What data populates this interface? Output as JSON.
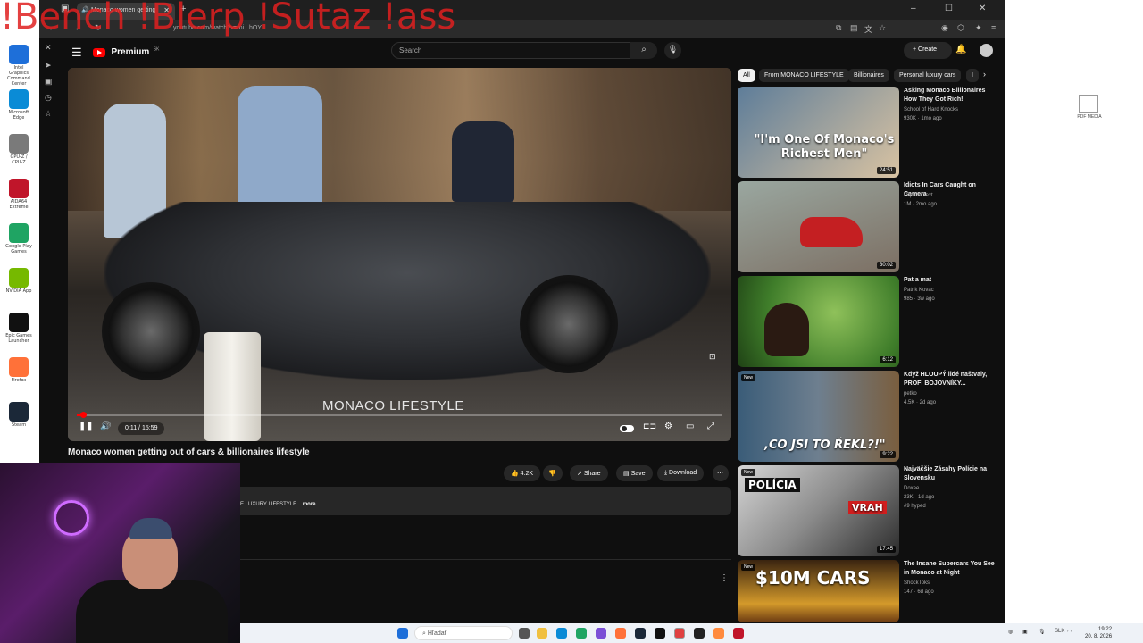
{
  "overlay_text": "!Bench !Blerp !Sutaz !ass",
  "desktop": {
    "icons": [
      {
        "label": "Intel Graphics Command Center",
        "color": "#1e6fd9"
      },
      {
        "label": "Microsoft Edge",
        "color": "#0a8bd6"
      },
      {
        "label": "GPU-Z / CPU-Z",
        "color": "#7a7a7a"
      },
      {
        "label": "AIDA64 Extreme",
        "color": "#c0152a"
      },
      {
        "label": "Google Play Games",
        "color": "#1fa463"
      },
      {
        "label": "NVIDIA App",
        "color": "#76b900"
      },
      {
        "label": "Epic Games Launcher",
        "color": "#111111"
      },
      {
        "label": "Firefox",
        "color": "#ff7139"
      },
      {
        "label": "Steam",
        "color": "#1b2838"
      }
    ],
    "right_icon_label": "PDF MEDIA"
  },
  "browser": {
    "tab_title": "Monaco women getting",
    "url": "youtube.com/watch?v=mi...hOY...",
    "new_tab": "+",
    "window_controls": [
      "–",
      "☐",
      "✕"
    ]
  },
  "youtube": {
    "logo_text": "Premium",
    "logo_sup": "SK",
    "search_placeholder": "Search",
    "create_label": "Create",
    "video": {
      "title": "Monaco women getting out of cars & billionaires lifestyle",
      "watermark": "MONACO LIFESTYLE",
      "time": "0:11 / 15:59",
      "progress_fraction": 0.0115,
      "likes": "4.2K",
      "share_label": "Share",
      "save_label": "Save",
      "download_label": "Download",
      "description": "E LUXURY LIFESTYLE ...",
      "more_label": "more"
    },
    "chips": [
      {
        "label": "All",
        "active": true
      },
      {
        "label": "From MONACO LIFESTYLE",
        "active": false
      },
      {
        "label": "Billionaires",
        "active": false
      },
      {
        "label": "Personal luxury cars",
        "active": false
      },
      {
        "label": "I",
        "active": false
      }
    ],
    "recommendations": [
      {
        "title": "Asking Monaco Billionaires How They Got Rich!",
        "channel": "School of Hard Knocks",
        "meta": "930K · 1mo ago",
        "duration": "24:51",
        "new": false,
        "thumb_text": "\"I'm One Of Monaco's Richest Men\"",
        "c1": "#5e7d99",
        "c2": "#d9c3a2"
      },
      {
        "title": "Idiots In Cars Caught on Camera",
        "channel": "Clip Context",
        "meta": "1M · 2mo ago",
        "duration": "30:02",
        "new": false,
        "thumb_text": "",
        "c1": "#9aa7a0",
        "c2": "#c41f22"
      },
      {
        "title": "Pat a mat",
        "channel": "Patrik Kovac",
        "meta": "985 · 3w ago",
        "duration": "6:12",
        "new": false,
        "thumb_text": "",
        "c1": "#3f7d2a",
        "c2": "#8fc15a"
      },
      {
        "title": "Když HLOUPÝ lidé naštvaly, PROFI BOJOVNÍKY...",
        "channel": "petko",
        "meta": "4.5K · 2d ago",
        "duration": "9:22",
        "new": true,
        "thumb_text": ",CO JSI TO ŘEKL?!\"",
        "c1": "#3a5c78",
        "c2": "#7a5e3e"
      },
      {
        "title": "Najväčšie Zásahy Polície na Slovensku",
        "channel": "Doxee",
        "meta": "23K · 1d ago",
        "extra": "#9 hyped",
        "duration": "17:45",
        "new": true,
        "thumb_text": "POLÍCIA",
        "thumb_text2": "VRAH",
        "c1": "#d6d6d6",
        "c2": "#2b2b2b"
      },
      {
        "title": "The Insane Supercars You See in Monaco at Night",
        "channel": "ShockToks",
        "meta": "147 · 6d ago",
        "duration": "",
        "new": true,
        "thumb_text": "$10M CARS",
        "c1": "#3a2410",
        "c2": "#d49a2b"
      }
    ]
  },
  "taskbar": {
    "search_placeholder": "Hľadať",
    "lang": "SLK",
    "time": "19:22",
    "date": "20. 8. 2026"
  }
}
